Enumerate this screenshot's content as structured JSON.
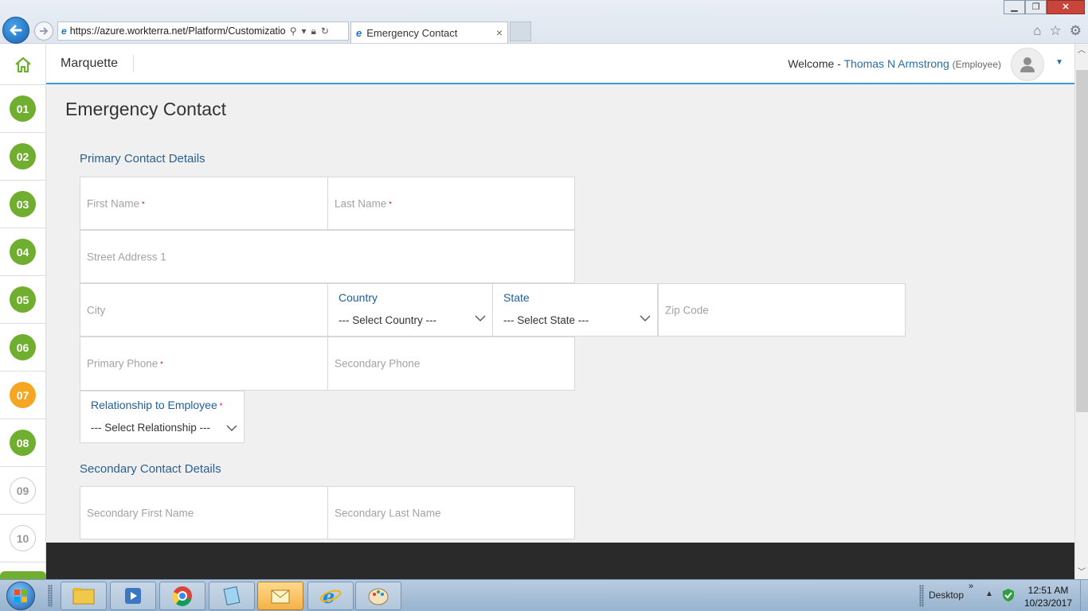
{
  "browser": {
    "url": "https://azure.workterra.net/Platform/Customizatio",
    "tab_title": "Emergency Contact",
    "tab_close": "×"
  },
  "header": {
    "brand": "Marquette",
    "welcome_label": "Welcome -",
    "user_name": "Thomas N Armstrong",
    "user_role": "(Employee)"
  },
  "steps": [
    {
      "label": "01",
      "state": "done"
    },
    {
      "label": "02",
      "state": "done"
    },
    {
      "label": "03",
      "state": "done"
    },
    {
      "label": "04",
      "state": "done"
    },
    {
      "label": "05",
      "state": "done"
    },
    {
      "label": "06",
      "state": "done"
    },
    {
      "label": "07",
      "state": "current"
    },
    {
      "label": "08",
      "state": "done"
    },
    {
      "label": "09",
      "state": "todo"
    },
    {
      "label": "10",
      "state": "todo"
    }
  ],
  "page": {
    "title": "Emergency Contact",
    "primary_section": "Primary Contact Details",
    "secondary_section": "Secondary Contact Details"
  },
  "primary": {
    "first_name": "First Name",
    "last_name": "Last Name",
    "street1": "Street Address 1",
    "city": "City",
    "country_label": "Country",
    "country_value": "--- Select Country ---",
    "state_label": "State",
    "state_value": "--- Select State ---",
    "zip": "Zip Code",
    "primary_phone": "Primary Phone",
    "secondary_phone": "Secondary Phone",
    "relationship_label": "Relationship to Employee",
    "relationship_value": "--- Select Relationship ---",
    "required_mark": "*"
  },
  "secondary": {
    "first_name": "Secondary First Name",
    "last_name": "Secondary Last Name"
  },
  "taskbar": {
    "desktop_label": "Desktop",
    "tray_chevron": "»",
    "time": "12:51 AM",
    "date": "10/23/2017"
  },
  "colors": {
    "step_done": "#6fae2e",
    "step_current": "#f5a623",
    "accent": "#3a9bd5",
    "link": "#2a6fa8"
  }
}
